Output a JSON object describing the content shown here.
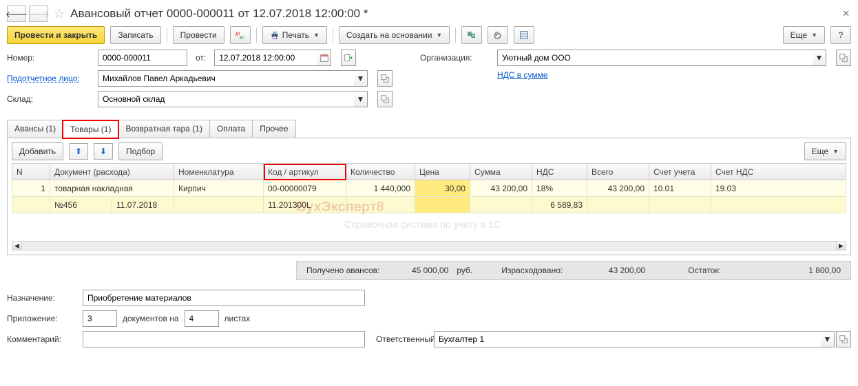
{
  "header": {
    "title": "Авансовый отчет 0000-000011 от 12.07.2018 12:00:00 *"
  },
  "toolbar": {
    "post_close": "Провести и закрыть",
    "save": "Записать",
    "post": "Провести",
    "print": "Печать",
    "create_basis": "Создать на основании",
    "more": "Еще"
  },
  "form": {
    "number_label": "Номер:",
    "number": "0000-000011",
    "date_label": "от:",
    "date": "12.07.2018 12:00:00",
    "org_label": "Организация:",
    "org": "Уютный дом ООО",
    "person_label": "Подотчетное лицо:",
    "person": "Михайлов Павел Аркадьевич",
    "nds_link": "НДС в сумме",
    "warehouse_label": "Склад:",
    "warehouse": "Основной склад"
  },
  "tabs": {
    "advances": "Авансы (1)",
    "goods": "Товары (1)",
    "tare": "Возвратная тара (1)",
    "payment": "Оплата",
    "other": "Прочее"
  },
  "pane": {
    "add": "Добавить",
    "pick": "Подбор",
    "more": "Еще"
  },
  "columns": {
    "n": "N",
    "doc": "Документ (расхода)",
    "nomen": "Номенклатура",
    "code": "Код / артикул",
    "qty": "Количество",
    "price": "Цена",
    "sum": "Сумма",
    "vat": "НДС",
    "total": "Всего",
    "account": "Счет учета",
    "vat_account": "Счет НДС"
  },
  "rows": [
    {
      "n": "1",
      "doc": "товарная накладная",
      "nomen": "Кирпич",
      "code": "00-00000079",
      "qty": "1 440,000",
      "price": "30,00",
      "sum": "43 200,00",
      "vat": "18%",
      "total": "43 200,00",
      "account": "10.01",
      "vat_account": "19.03"
    },
    {
      "doc_no": "№456",
      "doc_date": "11.07.2018",
      "code2": "11.201300L",
      "vat_sum": "6 589,83"
    }
  ],
  "totals": {
    "adv_label": "Получено авансов:",
    "adv_val": "45 000,00",
    "adv_cur": "руб.",
    "spent_label": "Израсходовано:",
    "spent_val": "43 200,00",
    "rest_label": "Остаток:",
    "rest_val": "1 800,00"
  },
  "bottom": {
    "purpose_label": "Назначение:",
    "purpose": "Приобретение материалов",
    "attach_label": "Приложение:",
    "attach_docs": "3",
    "attach_mid": "документов на",
    "attach_pages": "4",
    "attach_suffix": "листах",
    "comment_label": "Комментарий:",
    "comment": "",
    "resp_label": "Ответственный:",
    "resp": "Бухгалтер 1"
  },
  "watermark": {
    "w1": "БухЭксперт8",
    "w2": "Справочная система по учету в 1С"
  }
}
